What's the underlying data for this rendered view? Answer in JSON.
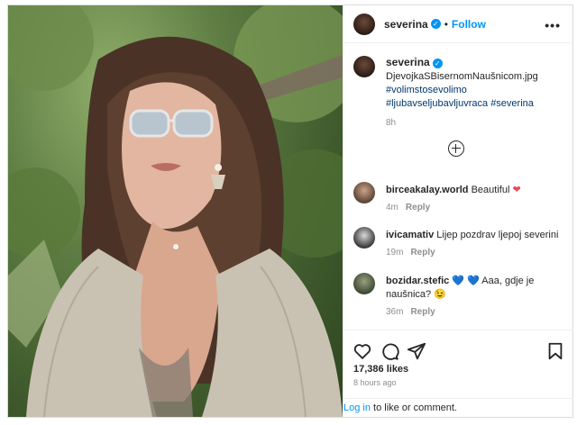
{
  "header": {
    "username": "severina",
    "follow_label": "Follow",
    "more_label": "•••"
  },
  "caption": {
    "username": "severina",
    "filename": "DjevojkaSBisernomNaušnicom.jpg",
    "hashtags": [
      "#volimstosevolimo",
      "#ljubavseljubavljuvraca",
      "#severina"
    ],
    "time": "8h"
  },
  "comments": [
    {
      "username": "birceakalay.world",
      "text": "Beautiful",
      "emoji": "❤",
      "time": "4m",
      "reply": "Reply"
    },
    {
      "username": "ivicamativ",
      "text": "Lijep pozdrav ljepoj severini",
      "time": "19m",
      "reply": "Reply"
    },
    {
      "username": "bozidar.stefic",
      "emoji": "💙 💙",
      "text": "Aaa, gdje je naušnica? 😉",
      "time": "36m",
      "reply": "Reply"
    }
  ],
  "likes": "17,386 likes",
  "posted_ago": "8 hours ago",
  "login": {
    "link": "Log in",
    "rest": " to like or comment."
  },
  "colors": {
    "accent": "#0095f6",
    "heart": "#ed4956"
  }
}
